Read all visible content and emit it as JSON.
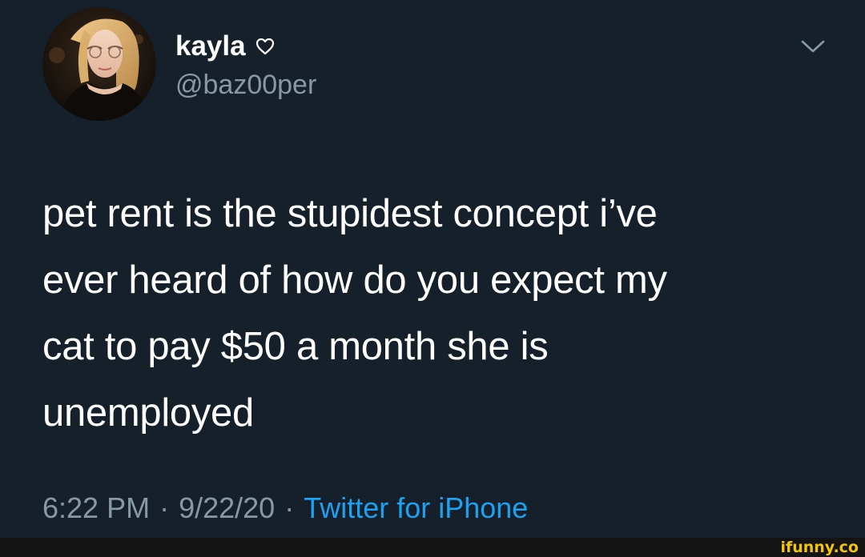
{
  "tweet": {
    "author": {
      "display_name": "kayla",
      "handle": "@baz00per",
      "name_icon": "heart-outline-icon",
      "avatar": "profile-photo"
    },
    "menu_icon": "chevron-down-icon",
    "text": "pet rent is the stupidest concept i’ve\never heard of how do you expect my\ncat to pay $50 a month she is\nunemployed",
    "time": "6:22 PM",
    "separator": "·",
    "date": "9/22/20",
    "source": "Twitter for iPhone"
  },
  "watermark": {
    "text": "ifunny.co"
  },
  "colors": {
    "background": "#15202b",
    "text_primary": "#ffffff",
    "text_secondary": "#8899a6",
    "link": "#1da1f2",
    "watermark": "#f2c40e"
  }
}
